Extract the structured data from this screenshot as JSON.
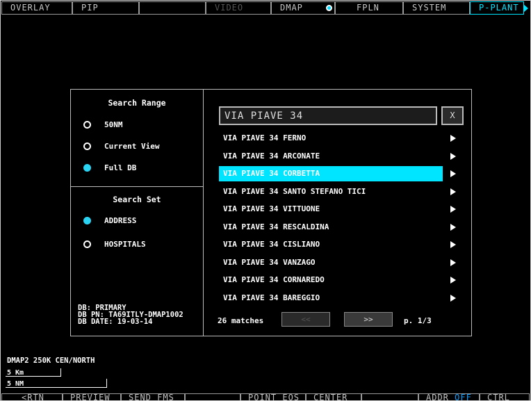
{
  "top_tabs": [
    {
      "label": "OVERLAY"
    },
    {
      "label": "PIP"
    },
    {
      "label": ""
    },
    {
      "label": "VIDEO"
    },
    {
      "label": "DMAP"
    },
    {
      "label": "FPLN"
    },
    {
      "label": "SYSTEM"
    },
    {
      "label": "P-PLANT"
    }
  ],
  "search_range": {
    "title": "Search Range",
    "options": [
      {
        "label": "50NM",
        "selected": false
      },
      {
        "label": "Current View",
        "selected": false
      },
      {
        "label": "Full DB",
        "selected": true
      }
    ]
  },
  "search_set": {
    "title": "Search Set",
    "options": [
      {
        "label": "ADDRESS",
        "selected": true
      },
      {
        "label": "HOSPITALS",
        "selected": false
      }
    ]
  },
  "db_info": {
    "line1": "DB: PRIMARY",
    "line2": "DB PN: TA69ITLY-DMAP1002",
    "line3": "DB DATE: 19-03-14"
  },
  "search": {
    "value": "VIA PIAVE 34",
    "clear_label": "X"
  },
  "results": [
    {
      "label": "VIA PIAVE 34 FERNO"
    },
    {
      "label": "VIA PIAVE 34 ARCONATE"
    },
    {
      "label": "VIA PIAVE 34 CORBETTA",
      "selected": true
    },
    {
      "label": "VIA PIAVE 34 SANTO STEFANO TICI"
    },
    {
      "label": "VIA PIAVE 34 VITTUONE"
    },
    {
      "label": "VIA PIAVE 34 RESCALDINA"
    },
    {
      "label": "VIA PIAVE 34 CISLIANO"
    },
    {
      "label": "VIA PIAVE 34 VANZAGO"
    },
    {
      "label": "VIA PIAVE 34 CORNAREDO"
    },
    {
      "label": "VIA PIAVE 34 BAREGGIO"
    }
  ],
  "pagination": {
    "matches": "26 matches",
    "prev_label": "<<",
    "next_label": ">>",
    "page": "p. 1/3"
  },
  "map_info": {
    "mode": "DMAP2   250K   CEN/NORTH",
    "scale_km": "5 Km",
    "scale_nm": "5 NM"
  },
  "softkeys": [
    {
      "label": "<RTN"
    },
    {
      "label": "PREVIEW"
    },
    {
      "label": "SEND FMS"
    },
    {
      "label": ""
    },
    {
      "label": "POINT EOS"
    },
    {
      "label": "CENTER"
    },
    {
      "label": ""
    },
    {
      "label": "ADDR"
    },
    {
      "label": "OFF"
    },
    {
      "label": "CTRL"
    }
  ],
  "colors": {
    "accent": "#00e5ff",
    "background": "#000000",
    "border": "#bdbdbd"
  }
}
